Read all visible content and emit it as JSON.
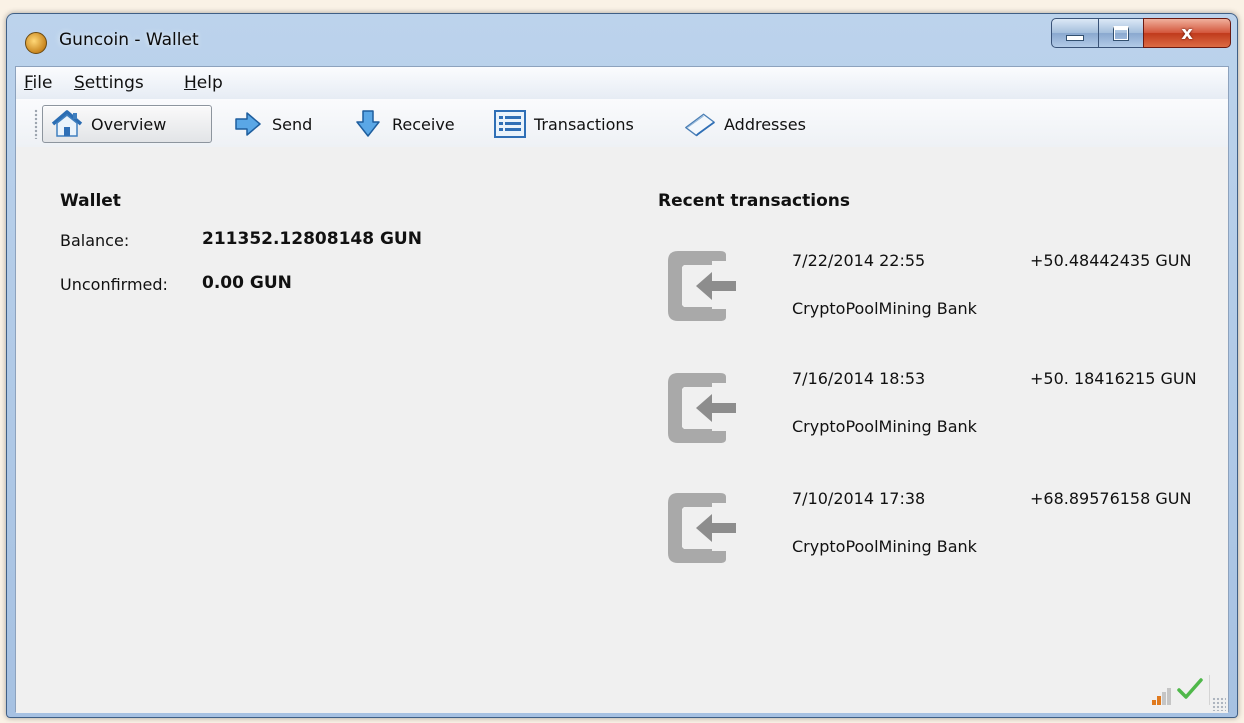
{
  "window": {
    "title": "Guncoin - Wallet",
    "close_glyph": "x"
  },
  "menu": {
    "file": {
      "accel": "F",
      "rest": "ile"
    },
    "settings": {
      "accel": "S",
      "rest": "ettings"
    },
    "help": {
      "accel": "H",
      "rest": "elp"
    }
  },
  "toolbar": {
    "overview": "Overview",
    "send": "Send",
    "receive": "Receive",
    "transactions": "Transactions",
    "addresses": "Addresses",
    "icons": [
      "home-icon",
      "send-arrow-icon",
      "receive-arrow-icon",
      "transactions-list-icon",
      "addresses-book-icon"
    ]
  },
  "wallet": {
    "title": "Wallet",
    "balance_label": "Balance:",
    "balance_value": "211352.12808148 GUN",
    "unconfirmed_label": "Unconfirmed:",
    "unconfirmed_value": "0.00 GUN"
  },
  "recent": {
    "title": "Recent transactions",
    "items": [
      {
        "date": "7/22/2014 22:55",
        "amount": "+50.48442435 GUN",
        "address": "CryptoPoolMining Bank"
      },
      {
        "date": "7/16/2014 18:53",
        "amount": "+50. 18416215 GUN",
        "address": "CryptoPoolMining Bank"
      },
      {
        "date": "7/10/2014 17:38",
        "amount": "+68.89576158 GUN",
        "address": "CryptoPoolMining Bank"
      }
    ]
  },
  "colors": {
    "incoming_icon": "#a9a9a9",
    "status_ok": "#4fb84a",
    "signal_active": "#e07a1f"
  }
}
